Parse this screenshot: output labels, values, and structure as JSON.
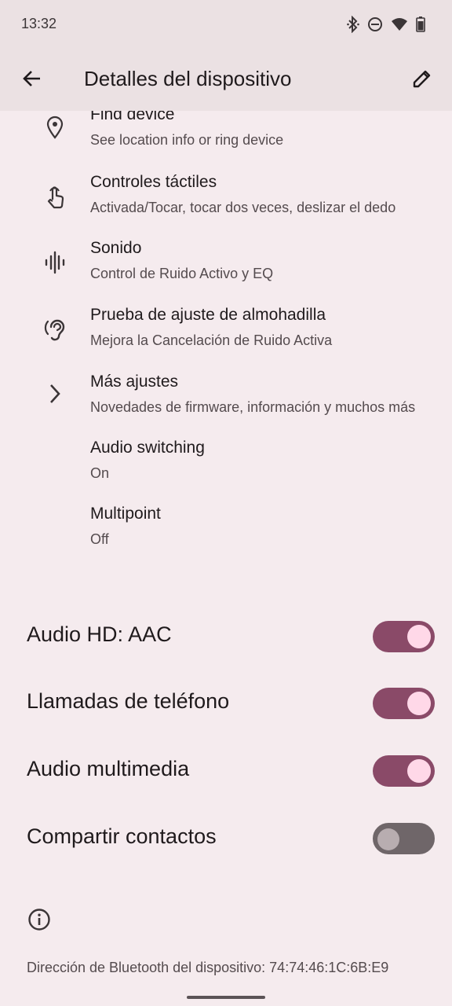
{
  "status_bar": {
    "time": "13:32",
    "icons": [
      "bluetooth-icon",
      "do-not-disturb-icon",
      "wifi-icon",
      "battery-icon"
    ]
  },
  "app_bar": {
    "title": "Detalles del dispositivo",
    "back_icon": "arrow-back-icon",
    "edit_icon": "pencil-icon"
  },
  "settings": [
    {
      "icon": "location-pin-icon",
      "title": "Find device",
      "subtitle": "See location info or ring device"
    },
    {
      "icon": "touch-icon",
      "title": "Controles táctiles",
      "subtitle": "Activada/Tocar, tocar dos veces, deslizar el dedo"
    },
    {
      "icon": "sound-wave-icon",
      "title": "Sonido",
      "subtitle": "Control de Ruido Activo y EQ"
    },
    {
      "icon": "ear-icon",
      "title": "Prueba de ajuste de almohadilla",
      "subtitle": "Mejora la Cancelación de Ruido Activa"
    },
    {
      "icon": "chevron-right-icon",
      "title": "Más ajustes",
      "subtitle": "Novedades de firmware, información y muchos más"
    },
    {
      "icon": "",
      "title": "Audio switching",
      "subtitle": "On"
    },
    {
      "icon": "",
      "title": "Multipoint",
      "subtitle": "Off"
    }
  ],
  "toggles": [
    {
      "label": "Audio HD: AAC",
      "checked": true
    },
    {
      "label": "Llamadas de teléfono",
      "checked": true
    },
    {
      "label": "Audio multimedia",
      "checked": true
    },
    {
      "label": "Compartir contactos",
      "checked": false
    }
  ],
  "footer": {
    "info_icon": "info-icon",
    "address": "Dirección de Bluetooth del dispositivo: 74:74:46:1C:6B:E9"
  },
  "colors": {
    "background": "#f5ebee",
    "app_bar": "#ebe1e3",
    "switch_on_track": "#8a4a68",
    "switch_on_thumb": "#ffd8e8",
    "switch_off_track": "#6f6669"
  }
}
